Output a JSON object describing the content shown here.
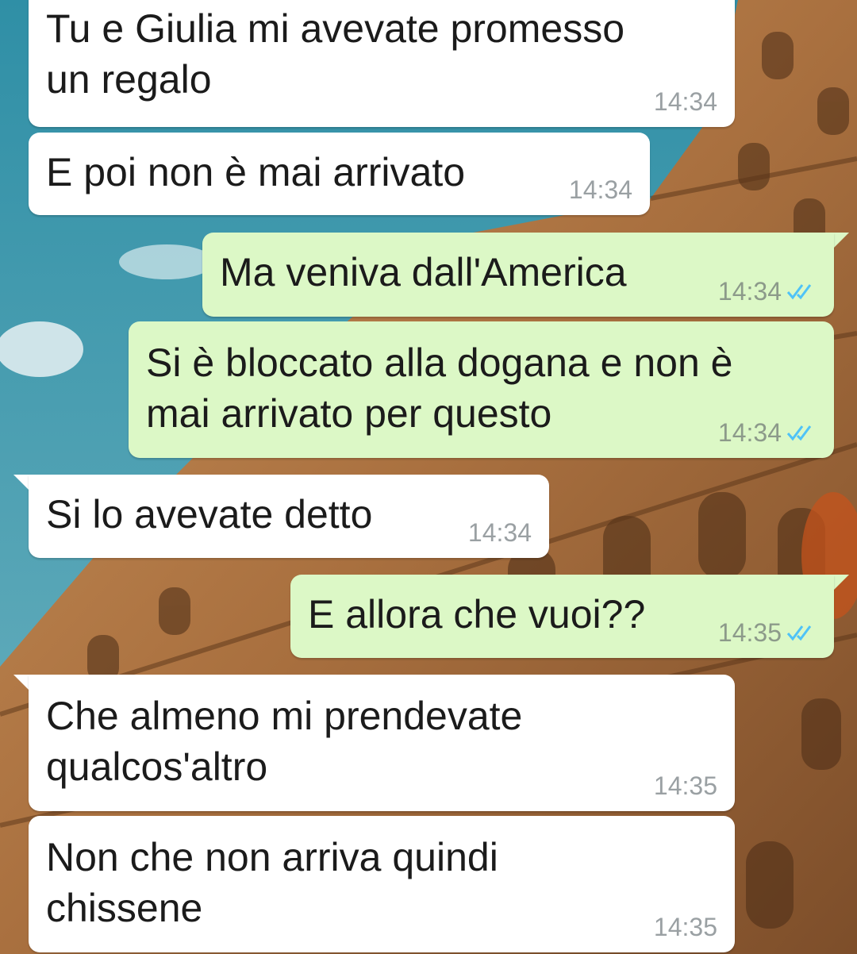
{
  "chat": {
    "messages": [
      {
        "direction": "in",
        "lines": "Tu e Giulia mi avevate promesso\nun regalo",
        "time": "14:34"
      },
      {
        "direction": "in",
        "lines": "E poi non è mai arrivato",
        "time": "14:34"
      },
      {
        "direction": "out",
        "lines": "Ma veniva dall'America",
        "time": "14:34",
        "status": "read"
      },
      {
        "direction": "out",
        "lines": "Si è bloccato alla dogana e non è\nmai arrivato per questo",
        "time": "14:34",
        "status": "read"
      },
      {
        "direction": "in",
        "lines": "Si lo avevate detto",
        "time": "14:34"
      },
      {
        "direction": "out",
        "lines": "E allora che vuoi??",
        "time": "14:35",
        "status": "read"
      },
      {
        "direction": "in",
        "lines": "Che almeno mi prendevate\nqualcos'altro",
        "time": "14:35"
      },
      {
        "direction": "in",
        "lines": "Non che non arriva quindi\nchissene",
        "time": "14:35"
      }
    ]
  },
  "colors": {
    "incoming_bubble": "#ffffff",
    "outgoing_bubble": "#dcf8c6",
    "read_ticks": "#4fc3f7",
    "time_text": "#8c9a8a"
  },
  "icons": {
    "read_receipt": "double-check-icon"
  }
}
